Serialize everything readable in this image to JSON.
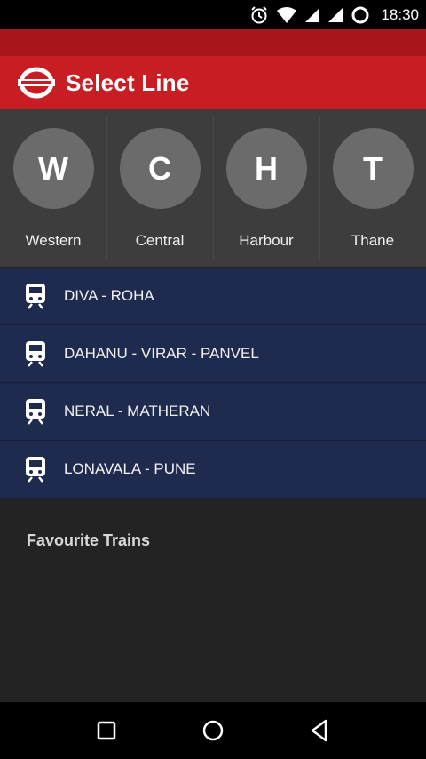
{
  "status_bar": {
    "time": "18:30",
    "icons": [
      "alarm-icon",
      "wifi-icon",
      "signal-icon",
      "signal-icon",
      "battery-icon"
    ]
  },
  "app_bar": {
    "title": "Select Line",
    "logo": "railway-logo-icon",
    "color": "#c91d24"
  },
  "lines": [
    {
      "letter": "W",
      "label": "Western"
    },
    {
      "letter": "C",
      "label": "Central"
    },
    {
      "letter": "H",
      "label": "Harbour"
    },
    {
      "letter": "T",
      "label": "Thane"
    }
  ],
  "routes": [
    {
      "label": "DIVA - ROHA",
      "icon": "train-icon"
    },
    {
      "label": "DAHANU - VIRAR - PANVEL",
      "icon": "train-icon"
    },
    {
      "label": "NERAL - MATHERAN",
      "icon": "train-icon"
    },
    {
      "label": "LONAVALA - PUNE",
      "icon": "train-icon"
    }
  ],
  "favourites": {
    "title": "Favourite Trains"
  },
  "nav_bar": {
    "buttons": [
      "recents-icon",
      "home-icon",
      "back-icon"
    ]
  }
}
